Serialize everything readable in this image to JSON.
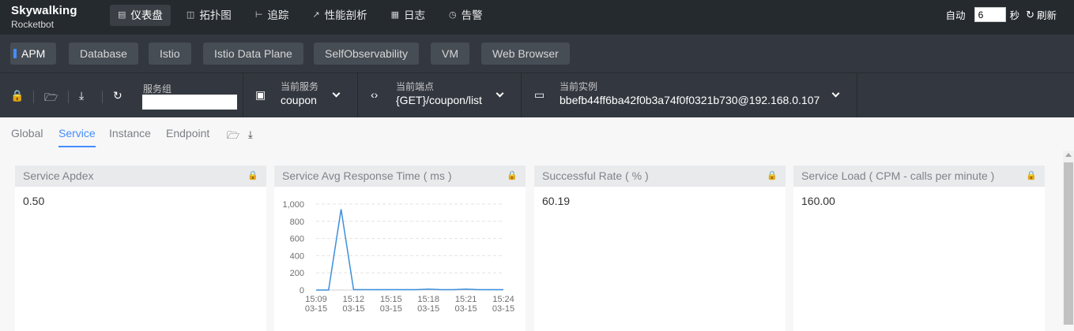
{
  "brand": {
    "name": "Skywalking",
    "sub": "Rocketbot"
  },
  "nav": [
    {
      "label": "仪表盘",
      "icon": "dashboard-icon",
      "active": true
    },
    {
      "label": "拓扑图",
      "icon": "topology-icon",
      "active": false
    },
    {
      "label": "追踪",
      "icon": "trace-icon",
      "active": false
    },
    {
      "label": "性能剖析",
      "icon": "profile-icon",
      "active": false
    },
    {
      "label": "日志",
      "icon": "log-icon",
      "active": false
    },
    {
      "label": "告警",
      "icon": "alarm-icon",
      "active": false
    }
  ],
  "refresh": {
    "auto_label": "自动",
    "interval": "6",
    "unit": "秒",
    "refresh_label": "刷新"
  },
  "layers": [
    "APM",
    "Database",
    "Istio",
    "Istio Data Plane",
    "SelfObservability",
    "VM",
    "Web Browser"
  ],
  "toolbar": {
    "group_label": "服务组",
    "group_value": "",
    "service_label": "当前服务",
    "service_value": "coupon",
    "endpoint_label": "当前端点",
    "endpoint_value": "{GET}/coupon/list",
    "instance_label": "当前实例",
    "instance_value": "bbefb44ff6ba42f0b3a74f0f0321b730@192.168.0.107"
  },
  "dashboard_tabs": [
    "Global",
    "Service",
    "Instance",
    "Endpoint"
  ],
  "cards": [
    {
      "title": "Service Apdex",
      "value": "0.50"
    },
    {
      "title": "Service Avg Response Time ( ms )",
      "value": ""
    },
    {
      "title": "Successful Rate ( % )",
      "value": "60.19"
    },
    {
      "title": "Service Load ( CPM - calls per minute )",
      "value": "160.00"
    }
  ],
  "colors": {
    "accent": "#448dfe",
    "nav_bg": "#252a2f",
    "bar_bg": "#333840",
    "line": "#3d8fdb"
  },
  "chart_data": {
    "type": "line",
    "ylim": [
      0,
      1000
    ],
    "yticks": [
      "1,000",
      "800",
      "600",
      "400",
      "200",
      "0"
    ],
    "x": [
      "15:09\n03-15",
      "15:10\n03-15",
      "15:11\n03-15",
      "15:12\n03-15",
      "15:13\n03-15",
      "15:14\n03-15",
      "15:15\n03-15",
      "15:16\n03-15",
      "15:17\n03-15",
      "15:18\n03-15",
      "15:19\n03-15",
      "15:20\n03-15",
      "15:21\n03-15",
      "15:22\n03-15",
      "15:23\n03-15",
      "15:24\n03-15"
    ],
    "xtick_labels": [
      {
        "time": "15:09",
        "date": "03-15"
      },
      {
        "time": "15:12",
        "date": "03-15"
      },
      {
        "time": "15:15",
        "date": "03-15"
      },
      {
        "time": "15:18",
        "date": "03-15"
      },
      {
        "time": "15:21",
        "date": "03-15"
      },
      {
        "time": "15:24",
        "date": "03-15"
      }
    ],
    "series": [
      {
        "values": [
          0,
          0,
          940,
          5,
          5,
          5,
          5,
          5,
          5,
          10,
          5,
          5,
          10,
          5,
          5,
          5
        ]
      }
    ]
  }
}
